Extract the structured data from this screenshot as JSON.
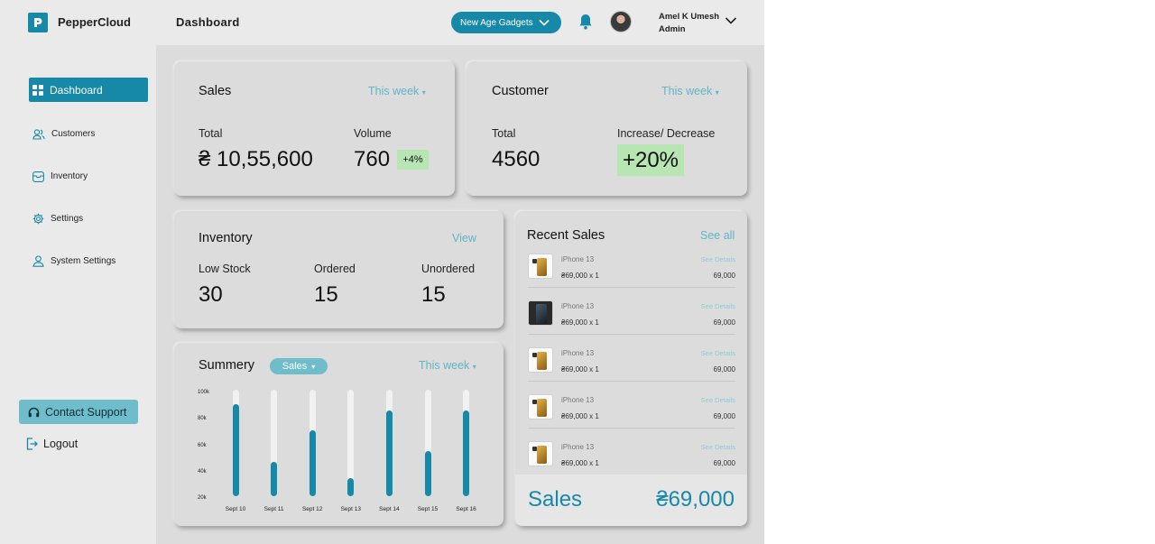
{
  "header": {
    "brand": "PepperCloud",
    "page_title": "Dashboard",
    "store_selector": "New Age Gadgets",
    "user_name": "Amel K Umesh",
    "user_role": "Admin"
  },
  "sidebar": {
    "items": [
      {
        "label": "Dashboard",
        "icon": "grid-icon",
        "active": true
      },
      {
        "label": "Customers",
        "icon": "users-icon",
        "active": false
      },
      {
        "label": "Inventory",
        "icon": "folder-icon",
        "active": false
      },
      {
        "label": "Settings",
        "icon": "gear-icon",
        "active": false
      },
      {
        "label": "System Settings",
        "icon": "user-icon",
        "active": false
      }
    ],
    "contact_support": "Contact Support",
    "logout": "Logout"
  },
  "sales_card": {
    "title": "Sales",
    "period": "This week",
    "total_label": "Total",
    "total_value": "₴ 10,55,600",
    "volume_label": "Volume",
    "volume_value": "760",
    "volume_change": "+4%"
  },
  "customer_card": {
    "title": "Customer",
    "period": "This week",
    "total_label": "Total",
    "total_value": "4560",
    "change_label": "Increase/ Decrease",
    "change_value": "+20%"
  },
  "inventory_card": {
    "title": "Inventory",
    "view_link": "View",
    "low_stock_label": "Low Stock",
    "low_stock_value": "30",
    "ordered_label": "Ordered",
    "ordered_value": "15",
    "unordered_label": "Unordered",
    "unordered_value": "15"
  },
  "summary_card": {
    "title": "Summery",
    "metric_selector": "Sales",
    "period": "This week"
  },
  "chart_data": {
    "type": "bar",
    "title": "Summery",
    "categories": [
      "Sept 10",
      "Sept 11",
      "Sept 12",
      "Sept 13",
      "Sept 14",
      "Sept 15",
      "Sept 16"
    ],
    "values": [
      92000,
      48000,
      72000,
      36000,
      87000,
      56000,
      87000
    ],
    "yticks": [
      "100k",
      "80k",
      "60k",
      "40k",
      "20k"
    ],
    "ylim": [
      20000,
      100000
    ],
    "colors": {
      "bar": "#1688a8",
      "track": "#f1f1f1"
    }
  },
  "recent_sales": {
    "title": "Recent Sales",
    "see_all": "See all",
    "items": [
      {
        "name": "iPhone 13",
        "price": "₴69,000 x 1",
        "total": "69,000",
        "details": "See Details",
        "thumb": "gold"
      },
      {
        "name": "iPhone 13",
        "price": "₴69,000 x 1",
        "total": "69,000",
        "details": "See Details",
        "thumb": "dark"
      },
      {
        "name": "iPhone 13",
        "price": "₴69,000 x 1",
        "total": "69,000",
        "details": "See Details",
        "thumb": "gold"
      },
      {
        "name": "iPhone 13",
        "price": "₴69,000 x 1",
        "total": "69,000",
        "details": "See Details",
        "thumb": "gold"
      },
      {
        "name": "iPhone 13",
        "price": "₴69,000 x 1",
        "total": "69,000",
        "details": "See Details",
        "thumb": "gold"
      }
    ],
    "footer_label": "Sales",
    "footer_value": "₴69,000"
  },
  "colors": {
    "accent": "#1688a8",
    "accent_light": "#6fbccb",
    "link": "#5fb5c7",
    "positive_bg": "#b7e6b3"
  }
}
